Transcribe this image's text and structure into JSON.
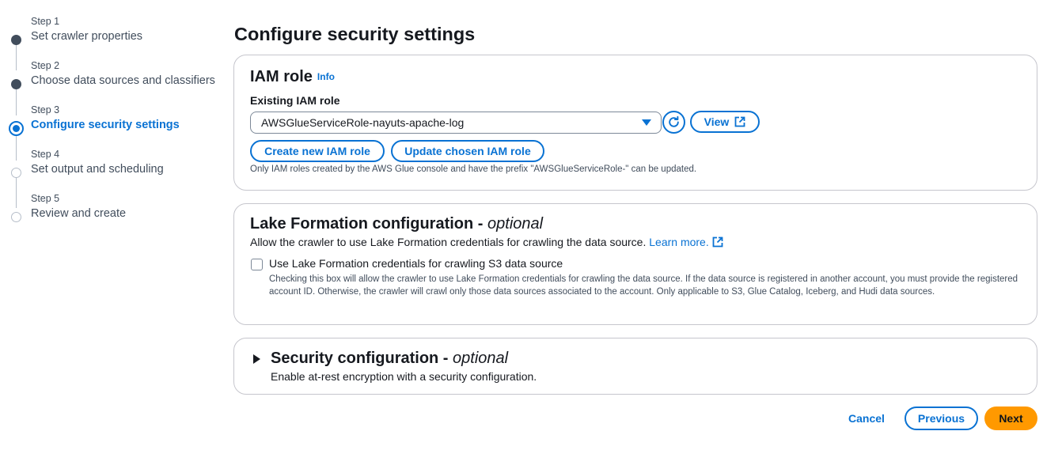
{
  "stepper": {
    "steps": [
      {
        "number": "Step 1",
        "title": "Set crawler properties",
        "state": "done"
      },
      {
        "number": "Step 2",
        "title": "Choose data sources and classifiers",
        "state": "done"
      },
      {
        "number": "Step 3",
        "title": "Configure security settings",
        "state": "active"
      },
      {
        "number": "Step 4",
        "title": "Set output and scheduling",
        "state": "pending"
      },
      {
        "number": "Step 5",
        "title": "Review and create",
        "state": "pending"
      }
    ]
  },
  "page": {
    "title": "Configure security settings"
  },
  "iam": {
    "heading": "IAM role",
    "info": "Info",
    "field_label": "Existing IAM role",
    "selected_role": "AWSGlueServiceRole-nayuts-apache-log",
    "view_label": "View",
    "create_label": "Create new IAM role",
    "update_label": "Update chosen IAM role",
    "hint": "Only IAM roles created by the AWS Glue console and have the prefix \"AWSGlueServiceRole-\" can be updated."
  },
  "lake": {
    "heading": "Lake Formation configuration - ",
    "heading_optional": "optional",
    "description": "Allow the crawler to use Lake Formation credentials for crawling the data source. ",
    "learn_more": "Learn more.",
    "checkbox_label": "Use Lake Formation credentials for crawling S3 data source",
    "checkbox_checked": false,
    "checkbox_description": "Checking this box will allow the crawler to use Lake Formation credentials for crawling the data source. If the data source is registered in another account, you must provide the registered account ID. Otherwise, the crawler will crawl only those data sources associated to the account. Only applicable to S3, Glue Catalog, Iceberg, and Hudi data sources."
  },
  "security": {
    "heading": "Security configuration - ",
    "heading_optional": "optional",
    "description": "Enable at-rest encryption with a security configuration.",
    "expanded": false
  },
  "footer": {
    "cancel": "Cancel",
    "previous": "Previous",
    "next": "Next"
  },
  "colors": {
    "accent": "#0972d3",
    "primary_button": "#ff9900",
    "text": "#16191f",
    "border": "#c6c6cd"
  }
}
